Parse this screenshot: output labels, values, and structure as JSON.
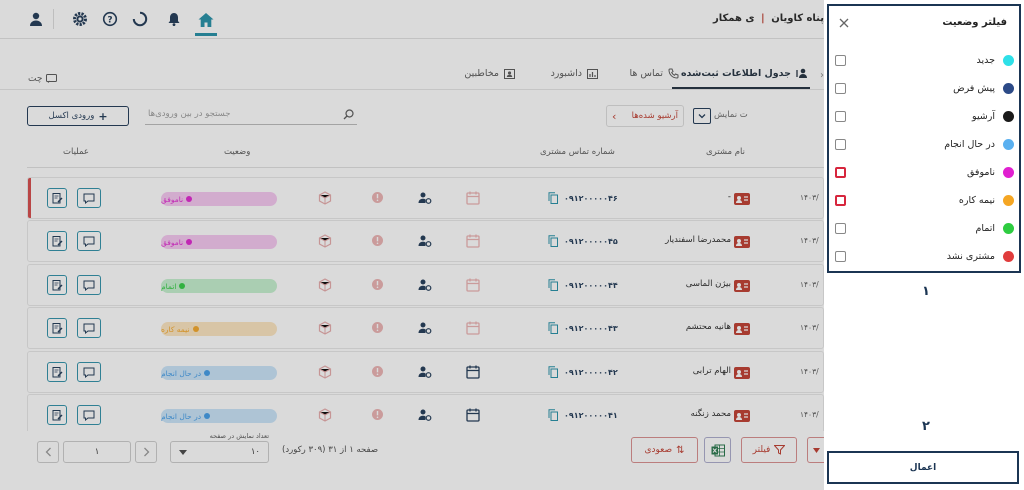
{
  "topbar": {
    "brand": "پناه کاویان",
    "brand_partial": "ی همکار",
    "icons": [
      "user-icon",
      "gear-icon",
      "help-icon",
      "loading-icon",
      "bell-icon",
      "home-icon"
    ]
  },
  "chat_label": "چت",
  "tabs": [
    {
      "label": "جدول اطلاعات ثبت‌شده",
      "icon": "contacts-icon",
      "active": true
    },
    {
      "label": "تماس ها",
      "icon": "phone-icon",
      "active": false
    },
    {
      "label": "داشبورد",
      "icon": "chart-icon",
      "active": false
    },
    {
      "label": "مخاطبین",
      "icon": "contact-card-icon",
      "active": false
    }
  ],
  "toolbar": {
    "excel_import": "ورودی اکسل",
    "search_placeholder": "جستجو در بین ورودی‌ها",
    "archived": "آرشیو شده‌ها",
    "view_label_partial": "ت نمایش"
  },
  "table": {
    "headers": {
      "actions": "عملیات",
      "status": "وضعیت",
      "phone": "شماره تماس مشتری",
      "name": "نام مشتری"
    },
    "rows": [
      {
        "name": "-",
        "phone": "۰۹۱۲۰۰۰۰۰۴۶",
        "status": "ناموفق",
        "status_color": "#e020d0",
        "status_bg": "#f6c6f0",
        "date": "۱۴۰۳/"
      },
      {
        "name": "محمدرضا اسفندیار",
        "phone": "۰۹۱۲۰۰۰۰۰۴۵",
        "status": "ناموفق",
        "status_color": "#e020d0",
        "status_bg": "#f6c6f0",
        "date": "۱۴۰۳/"
      },
      {
        "name": "بیژن الماسی",
        "phone": "۰۹۱۲۰۰۰۰۰۴۴",
        "status": "اتمام",
        "status_color": "#2ecc40",
        "status_bg": "#c3f0cd",
        "date": "۱۴۰۳/"
      },
      {
        "name": "هانیه محتشم",
        "phone": "۰۹۱۲۰۰۰۰۰۴۳",
        "status": "نیمه کاره",
        "status_color": "#f5a623",
        "status_bg": "#fde5bf",
        "date": "۱۴۰۳/"
      },
      {
        "name": "الهام ترابی",
        "phone": "۰۹۱۲۰۰۰۰۰۴۲",
        "status": "در حال انجام",
        "status_color": "#3d9ae8",
        "status_bg": "#c9e4f9",
        "date": "۱۴۰۳/"
      },
      {
        "name": "محمد زنگنه",
        "phone": "۰۹۱۲۰۰۰۰۰۴۱",
        "status": "در حال انجام",
        "status_color": "#3d9ae8",
        "status_bg": "#c9e4f9",
        "date": "۱۴۰۳/"
      }
    ]
  },
  "pager": {
    "page_info": "صفحه ۱ از ۳۱ (۳۰۹ رکورد)",
    "rows_per_page_label": "تعداد نمایش در صفحه",
    "rows_per_page_value": "۱۰",
    "page_input_value": "۱",
    "sort_label": "صعودی",
    "filter_label": "فیلتر"
  },
  "filter_panel": {
    "title": "فیلتر وضعیت",
    "options": [
      {
        "label": "جدید",
        "color": "#2ee0e8",
        "marked": false
      },
      {
        "label": "پیش فرض",
        "color": "#2c4a87",
        "marked": false
      },
      {
        "label": "آرشیو",
        "color": "#1a1a1a",
        "marked": false
      },
      {
        "label": "در حال انجام",
        "color": "#5ab0f0",
        "marked": false
      },
      {
        "label": "ناموفق",
        "color": "#e020d0",
        "marked": true
      },
      {
        "label": "نیمه کاره",
        "color": "#f5a623",
        "marked": true
      },
      {
        "label": "اتمام",
        "color": "#2ecc40",
        "marked": false
      },
      {
        "label": "مشتری نشد",
        "color": "#e03c3c",
        "marked": false
      }
    ],
    "annotation_1": "۱",
    "annotation_2": "۲",
    "apply_label": "اعمال"
  },
  "colors": {
    "primary": "#1b3553",
    "accent_teal": "#2a8fa8",
    "danger": "#c0392b",
    "marker": "#d7263d"
  }
}
